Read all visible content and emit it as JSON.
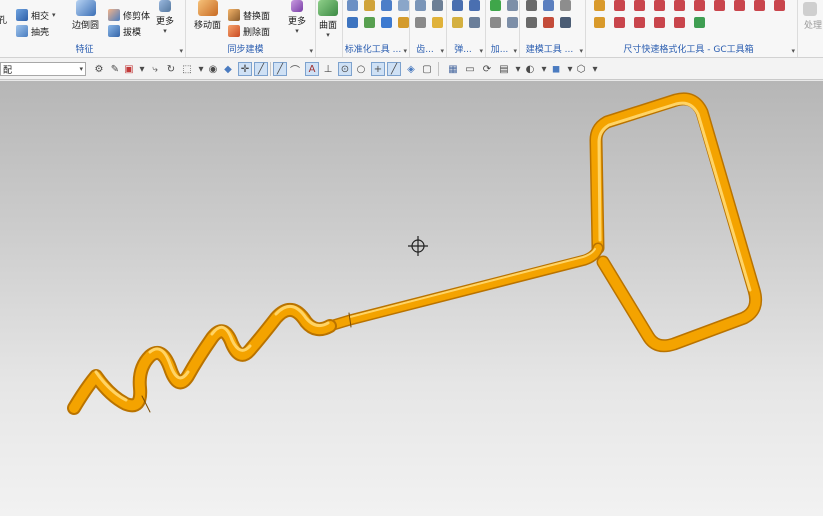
{
  "ribbon": {
    "groups": [
      {
        "id": "feature",
        "label": "特征"
      },
      {
        "id": "sync",
        "label": "同步建模"
      },
      {
        "id": "surface",
        "label": ""
      },
      {
        "id": "std",
        "label": "标准化工具 ..."
      },
      {
        "id": "gear",
        "label": "齿..."
      },
      {
        "id": "spring",
        "label": "弹..."
      },
      {
        "id": "add",
        "label": "加..."
      },
      {
        "id": "modeltool",
        "label": "建模工具 ..."
      },
      {
        "id": "dim",
        "label": "尺寸快速格式化工具 - GC工具箱"
      }
    ],
    "feature": {
      "hole_label": "孔",
      "intersect_label": "相交",
      "shell_label": "抽壳",
      "edge_blend_label": "边倒圆",
      "trim_body_label": "修剪体",
      "draft_label": "拔模",
      "more_label": "更多"
    },
    "sync": {
      "move_face_label": "移动面",
      "replace_face_label": "替换面",
      "delete_face_label": "删除面",
      "more_label": "更多"
    },
    "surface": {
      "surface_label": "曲面"
    },
    "right_edge_label": "处理"
  },
  "toolbar": {
    "selection_filter_value": "配"
  },
  "colors": {
    "model": "#f2a100",
    "model_shadow": "#c27300",
    "model_highlight": "#ffd466",
    "accent": "#2a5db0"
  }
}
